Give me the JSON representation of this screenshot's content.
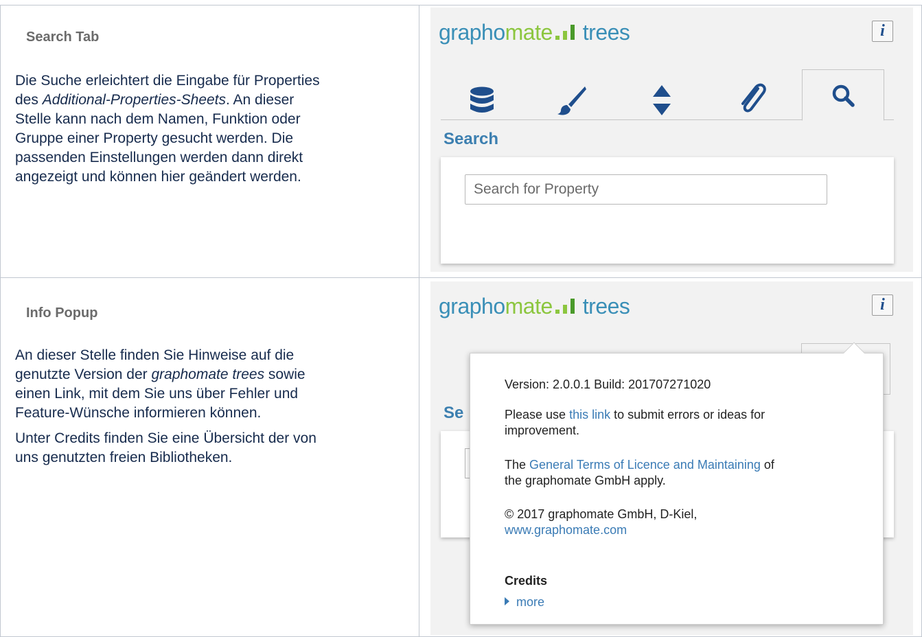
{
  "row1": {
    "heading": "Search Tab",
    "para_1": "Die Suche erleichtert die Eingabe für Properties",
    "para_2a": "des ",
    "para_2b": "Additional-Properties-Sheets",
    "para_2c": ". An dieser",
    "para_3": "Stelle kann nach dem Namen, Funktion oder",
    "para_4": "Gruppe einer Property gesucht werden. Die",
    "para_5": "passenden Einstellungen werden dann direkt",
    "para_6": "angezeigt und können hier geändert werden."
  },
  "row2": {
    "heading": "Info Popup",
    "para_1": "An dieser Stelle finden Sie Hinweise auf die",
    "para_2a": "genutzte Version der ",
    "para_2b": "graphomate trees",
    "para_2c": " sowie",
    "para_3": "einen Link, mit dem Sie uns über Fehler und",
    "para_4": "Feature-Wünsche informieren können.",
    "para_5": "Unter Credits finden Sie eine Übersicht der von",
    "para_6": "uns genutzten freien Bibliotheken."
  },
  "logo": {
    "part1": "grapho",
    "part2": "mate",
    "part3": "trees",
    "colors": {
      "blue": "#3a8fb7",
      "green": "#8cc63f",
      "dark_green": "#4a9a2a"
    }
  },
  "info_button": {
    "glyph": "i"
  },
  "tabs": [
    {
      "name": "database",
      "icon": "database-icon"
    },
    {
      "name": "style",
      "icon": "brush-icon"
    },
    {
      "name": "sort",
      "icon": "sort-arrows-icon"
    },
    {
      "name": "attachment",
      "icon": "paperclip-icon"
    },
    {
      "name": "search",
      "icon": "search-icon",
      "active": true
    }
  ],
  "search": {
    "label": "Search",
    "placeholder": "Search for Property"
  },
  "ghost": {
    "label_fragment": "Se"
  },
  "popup": {
    "version": "Version: 2.0.0.1 Build: 201707271020",
    "please_pre": "Please use ",
    "please_link": "this link",
    "please_post": " to submit errors or ideas for",
    "please_line2": "improvement.",
    "terms_pre": "The ",
    "terms_link": "General Terms of Licence and Maintaining",
    "terms_post": " of",
    "terms_line2": "the graphomate GmbH apply.",
    "copyright": "© 2017 graphomate GmbH, D-Kiel,",
    "website": "www.graphomate.com",
    "credits_label": "Credits",
    "more_label": "more"
  },
  "colors": {
    "accent_blue": "#3c7fb0",
    "link_blue": "#3a7bb5",
    "icon_navy": "#1f4e8c",
    "panel_bg": "#f2f2f2"
  }
}
